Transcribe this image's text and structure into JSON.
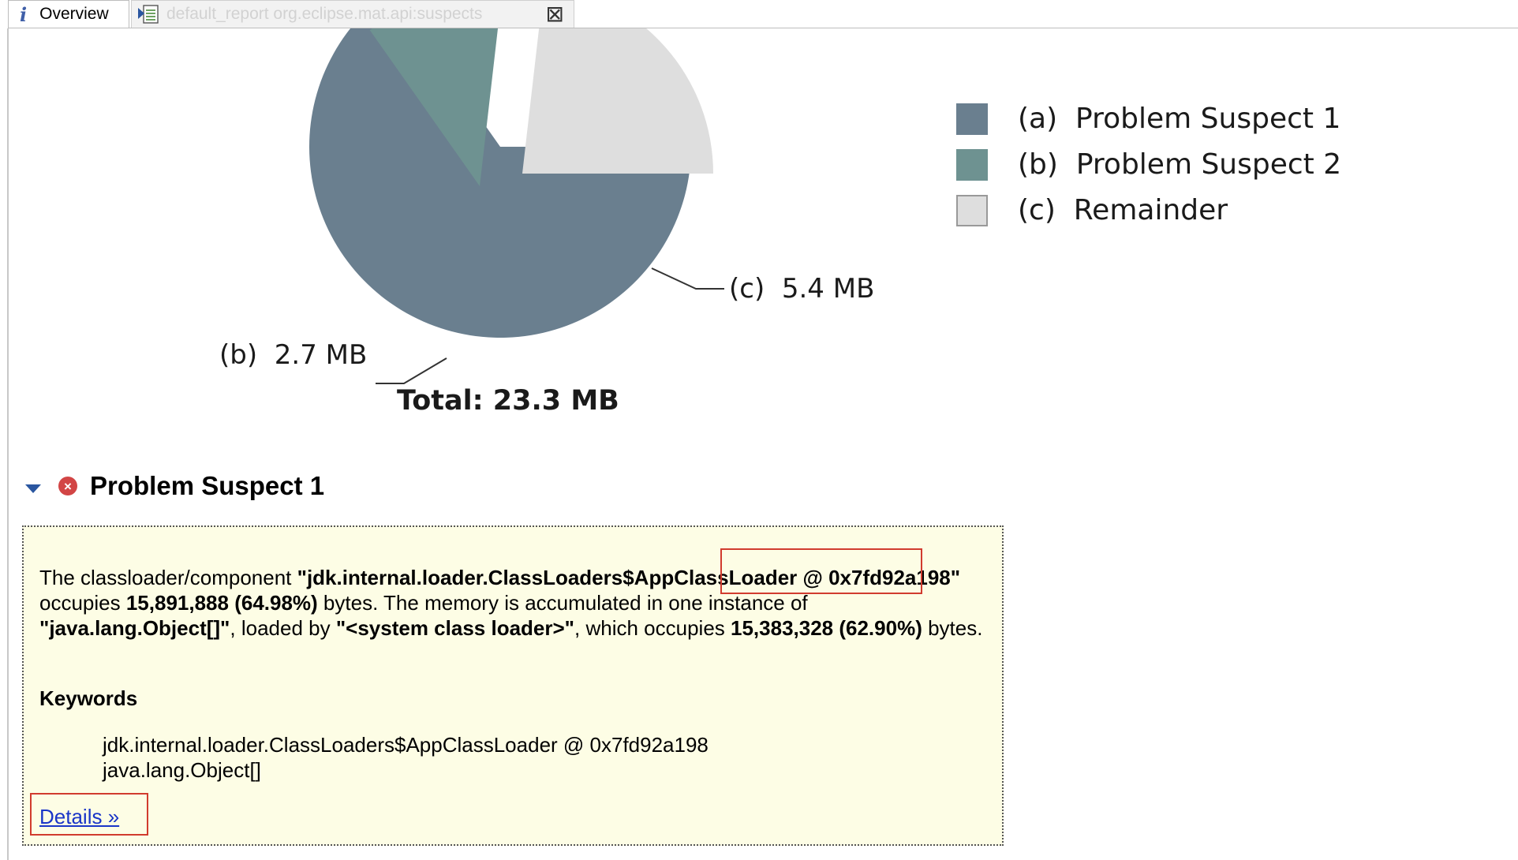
{
  "tabs": {
    "overview_label": "Overview",
    "report_label": "default_report  org.eclipse.mat.api:suspects"
  },
  "icons": {
    "overview": "info-icon",
    "report": "report-icon",
    "close": "close-icon",
    "section_toggle": "collapse-triangle-icon",
    "section_status": "error-icon"
  },
  "chart_data": {
    "type": "pie",
    "categories": [
      "Problem Suspect 1",
      "Problem Suspect 2",
      "Remainder"
    ],
    "values": [
      15.2,
      2.7,
      5.4
    ],
    "unit": "MB",
    "colors": [
      "#6a7f8f",
      "#6e9291",
      "#dedede"
    ],
    "legend": [
      {
        "key": "(a)",
        "label": "Problem Suspect 1"
      },
      {
        "key": "(b)",
        "label": "Problem Suspect 2"
      },
      {
        "key": "(c)",
        "label": "Remainder"
      }
    ],
    "slice_labels": {
      "b": {
        "key": "(b)",
        "value": "2.7 MB"
      },
      "c": {
        "key": "(c)",
        "value": "5.4 MB"
      }
    },
    "total_label": "Total: 23.3 MB",
    "legend_position": "right"
  },
  "suspect": {
    "title": "Problem Suspect 1",
    "desc": {
      "p1": "The classloader/component ",
      "b1": "\"jdk.internal.loader.ClassLoaders$AppClassLoader @ 0x7fd92a198\"",
      "p2": " occupies ",
      "b2": "15,891,888 (64.98%)",
      "p3": " bytes. The memory is accumulated in one instance of ",
      "b3": "\"java.lang.Object[]\"",
      "p4": ", loaded by ",
      "b4": "\"<system class loader>\"",
      "p5": ", which occupies ",
      "b5": "15,383,328 (62.90%)",
      "p6": " bytes."
    },
    "keywords_title": "Keywords",
    "keywords": [
      "jdk.internal.loader.ClassLoaders$AppClassLoader @ 0x7fd92a198",
      "java.lang.Object[]"
    ],
    "details_link": "Details »"
  }
}
